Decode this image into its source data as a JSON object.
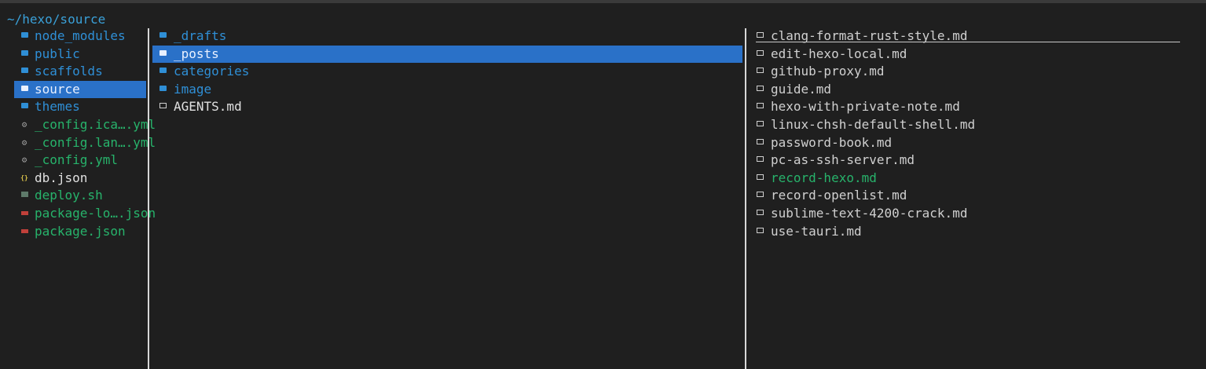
{
  "path": "~/hexo/source",
  "left_pane": {
    "items": [
      {
        "label": "node_modules",
        "kind": "folder",
        "color": "#2f8fd6"
      },
      {
        "label": "public",
        "kind": "folder",
        "color": "#2f8fd6"
      },
      {
        "label": "scaffolds",
        "kind": "folder",
        "color": "#2f8fd6"
      },
      {
        "label": "source",
        "kind": "folder",
        "color": "#2f8fd6",
        "selected": true
      },
      {
        "label": "themes",
        "kind": "folder",
        "color": "#2f8fd6"
      },
      {
        "label": "_config.ica….yml",
        "kind": "gear",
        "color": "#27b36b"
      },
      {
        "label": "_config.lan….yml",
        "kind": "gear",
        "color": "#27b36b"
      },
      {
        "label": "_config.yml",
        "kind": "gear",
        "color": "#27b36b"
      },
      {
        "label": "db.json",
        "kind": "json",
        "color": "#e0e0e0"
      },
      {
        "label": "deploy.sh",
        "kind": "shell",
        "color": "#27b36b"
      },
      {
        "label": "package-lo….json",
        "kind": "npm",
        "color": "#27b36b"
      },
      {
        "label": "package.json",
        "kind": "npm",
        "color": "#27b36b"
      }
    ]
  },
  "mid_pane": {
    "items": [
      {
        "label": "_drafts",
        "kind": "folder",
        "color": "#2f8fd6"
      },
      {
        "label": "_posts",
        "kind": "folder",
        "color": "#2f8fd6",
        "selected": true
      },
      {
        "label": "categories",
        "kind": "folder",
        "color": "#2f8fd6"
      },
      {
        "label": "image",
        "kind": "folder",
        "color": "#2f8fd6"
      },
      {
        "label": "AGENTS.md",
        "kind": "markdown",
        "color": "#e0e0e0"
      }
    ]
  },
  "right_pane": {
    "items": [
      {
        "label": "clang-format-rust-style.md",
        "kind": "markdown",
        "color": "#d0d0d0",
        "cursor": true
      },
      {
        "label": "edit-hexo-local.md",
        "kind": "markdown",
        "color": "#d0d0d0"
      },
      {
        "label": "github-proxy.md",
        "kind": "markdown",
        "color": "#d0d0d0"
      },
      {
        "label": "guide.md",
        "kind": "markdown",
        "color": "#d0d0d0"
      },
      {
        "label": "hexo-with-private-note.md",
        "kind": "markdown",
        "color": "#d0d0d0"
      },
      {
        "label": "linux-chsh-default-shell.md",
        "kind": "markdown",
        "color": "#d0d0d0"
      },
      {
        "label": "password-book.md",
        "kind": "markdown",
        "color": "#d0d0d0"
      },
      {
        "label": "pc-as-ssh-server.md",
        "kind": "markdown",
        "color": "#d0d0d0"
      },
      {
        "label": "record-hexo.md",
        "kind": "markdown",
        "color": "#27b36b"
      },
      {
        "label": "record-openlist.md",
        "kind": "markdown",
        "color": "#d0d0d0"
      },
      {
        "label": "sublime-text-4200-crack.md",
        "kind": "markdown",
        "color": "#d0d0d0"
      },
      {
        "label": "use-tauri.md",
        "kind": "markdown",
        "color": "#d0d0d0"
      }
    ]
  },
  "icons": {
    "folder": "folder-icon",
    "gear": "gear-icon",
    "json": "json-braces-icon",
    "shell": "terminal-icon",
    "npm": "npm-icon",
    "markdown": "markdown-file-icon"
  }
}
